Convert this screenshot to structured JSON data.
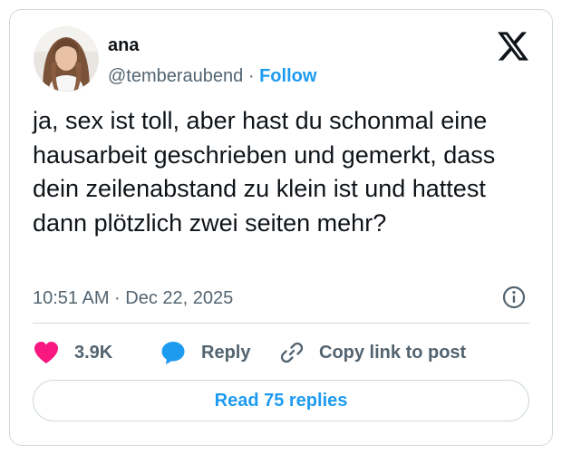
{
  "author": {
    "name": "ana",
    "handle": "@temberaubend",
    "separator": "·",
    "follow_label": "Follow"
  },
  "tweet": {
    "text": "ja, sex ist toll, aber hast du schonmal eine hausarbeit geschrieben und gemerkt, dass dein zeilenabstand zu klein ist und hattest dann plötzlich zwei seiten mehr?",
    "timestamp": "10:51 AM · Dec 22, 2025"
  },
  "actions": {
    "likes_count": "3.9K",
    "reply_label": "Reply",
    "copy_link_label": "Copy link to post"
  },
  "read_replies_label": "Read 75 replies",
  "colors": {
    "like": "#f91880",
    "reply_bubble": "#1d9bf0",
    "link": "#1d9bf0",
    "muted": "#536471"
  },
  "icons": [
    "x-logo-icon",
    "info-icon",
    "heart-icon",
    "reply-bubble-icon",
    "link-icon"
  ]
}
